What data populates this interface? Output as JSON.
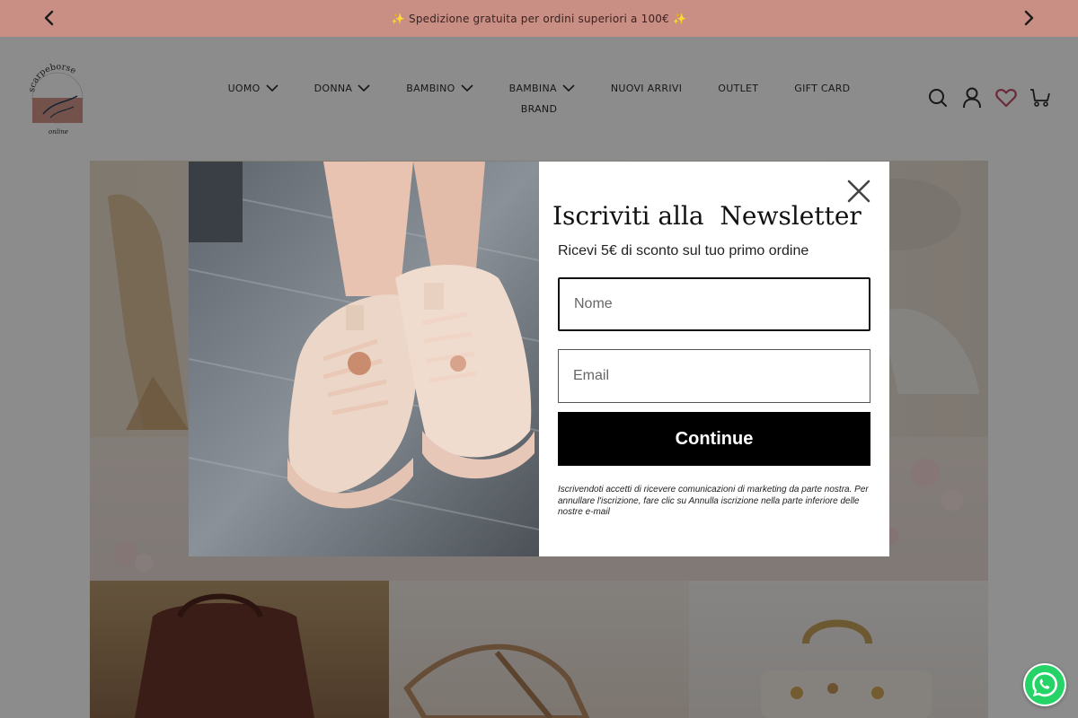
{
  "announcement": {
    "text": "✨ Spedizione gratuita per ordini superiori a 100€ ✨"
  },
  "header": {
    "logo_text_top": "scarpeborse",
    "logo_text_bottom": "online",
    "nav": [
      {
        "label": "UOMO",
        "has_dropdown": true
      },
      {
        "label": "DONNA",
        "has_dropdown": true
      },
      {
        "label": "BAMBINO",
        "has_dropdown": true
      },
      {
        "label": "BAMBINA",
        "has_dropdown": true
      },
      {
        "label": "NUOVI ARRIVI",
        "has_dropdown": false
      },
      {
        "label": "OUTLET",
        "has_dropdown": false
      },
      {
        "label": "GIFT CARD",
        "has_dropdown": false
      },
      {
        "label": "BRAND",
        "has_dropdown": false
      }
    ],
    "icons": [
      "search-icon",
      "account-icon",
      "wishlist-icon",
      "cart-icon"
    ]
  },
  "popup": {
    "title": "Iscriviti alla  Newsletter",
    "subtitle": "Ricevi 5€ di sconto sul tuo primo ordine",
    "name_placeholder": "Nome",
    "email_placeholder": "Email",
    "button_label": "Continue",
    "disclaimer": "Iscrivendoti accetti di ricevere comunicazioni di marketing da parte nostra. Per annullare l'iscrizione, fare clic su Annulla iscrizione nella parte inferiore delle nostre e-mail"
  },
  "colors": {
    "announcement_bg": "#c98f84",
    "button_bg": "#000000",
    "wishlist_accent": "#c44d6a",
    "whatsapp": "#25d366"
  }
}
